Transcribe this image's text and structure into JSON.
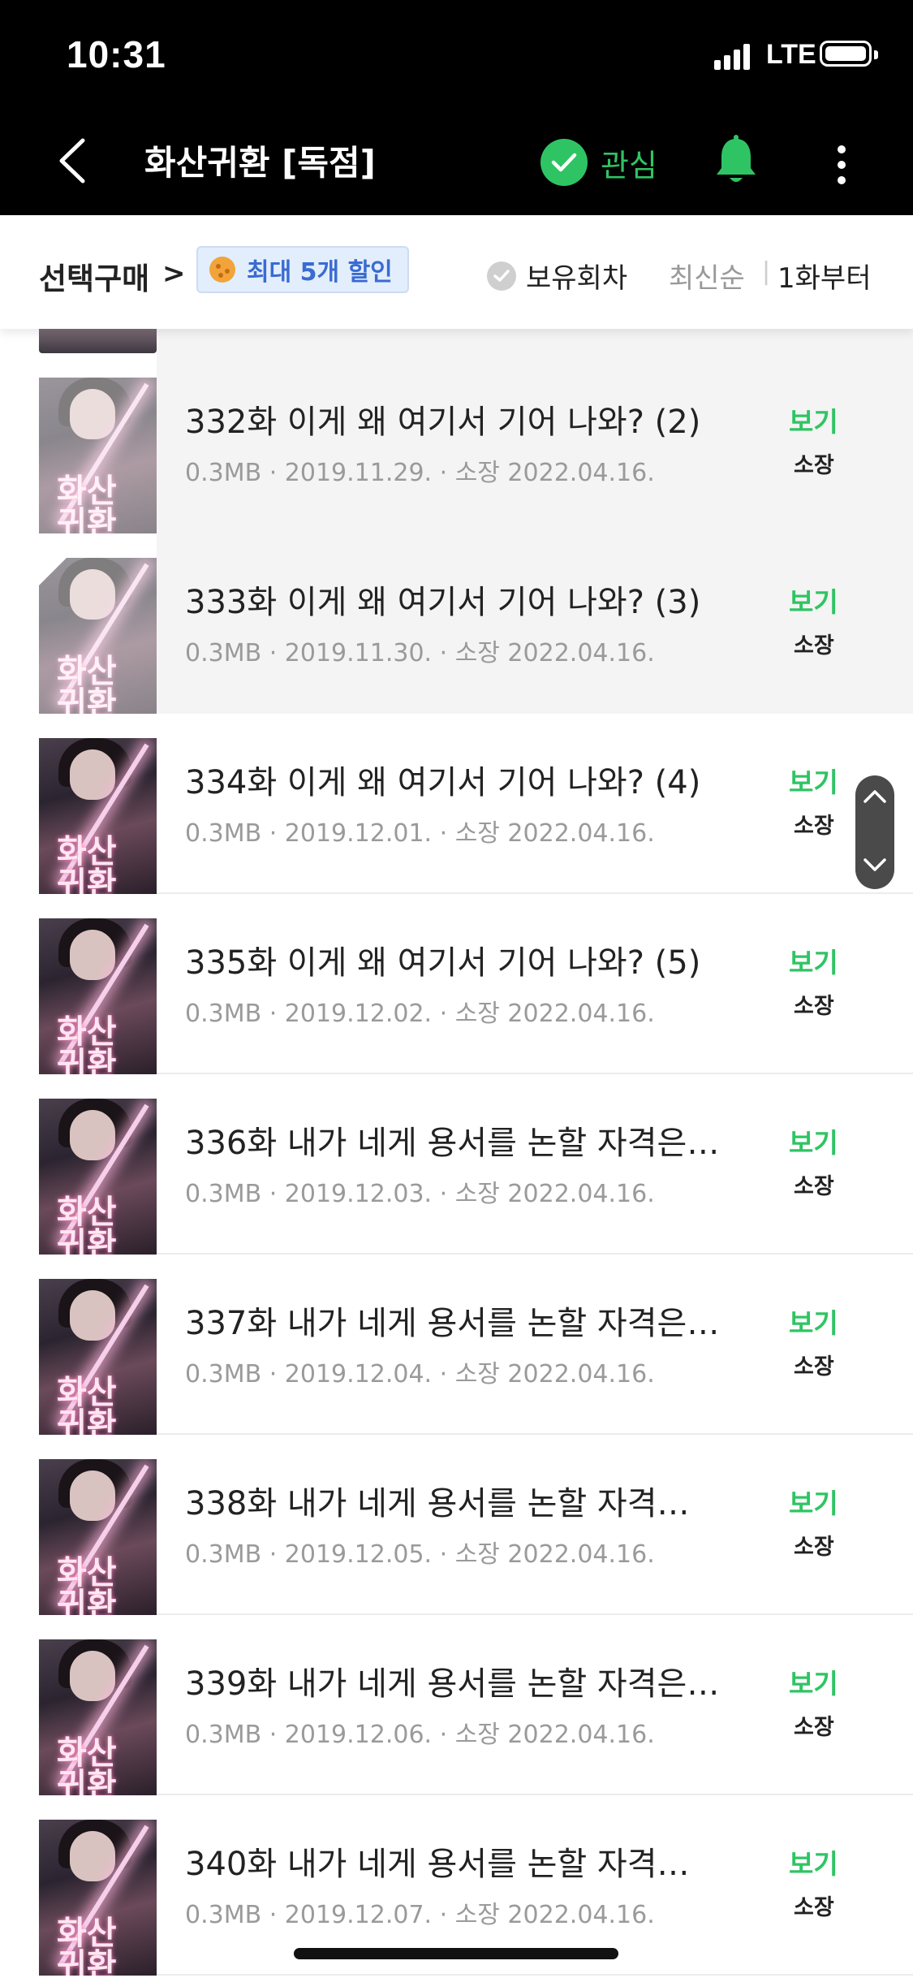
{
  "status_bar": {
    "time": "10:31",
    "network": "LTE"
  },
  "header": {
    "title": "화산귀환 [독점]",
    "interest_label": "관심"
  },
  "filter": {
    "select_buy": "선택구매",
    "chevron": ">",
    "discount": "최대 5개 할인",
    "owned": "보유회차",
    "sort_newest": "최신순",
    "separator": "|",
    "sort_first": "1화부터"
  },
  "cover_title": "화산\n귀환",
  "episodes": [
    {
      "title": "332화 이게 왜 여기서 기어 나와? (2)",
      "meta": "0.3MB · 2019.11.29. · 소장 2022.04.16.",
      "action": "보기",
      "owned": "소장",
      "read": true
    },
    {
      "title": "333화 이게 왜 여기서 기어 나와? (3)",
      "meta": "0.3MB · 2019.11.30. · 소장 2022.04.16.",
      "action": "보기",
      "owned": "소장",
      "read": true
    },
    {
      "title": "334화 이게 왜 여기서 기어 나와? (4)",
      "meta": "0.3MB · 2019.12.01. · 소장 2022.04.16.",
      "action": "보기",
      "owned": "소장",
      "read": false
    },
    {
      "title": "335화 이게 왜 여기서 기어 나와? (5)",
      "meta": "0.3MB · 2019.12.02. · 소장 2022.04.16.",
      "action": "보기",
      "owned": "소장",
      "read": false
    },
    {
      "title": "336화 내가 네게 용서를 논할 자격은…",
      "meta": "0.3MB · 2019.12.03. · 소장 2022.04.16.",
      "action": "보기",
      "owned": "소장",
      "read": false
    },
    {
      "title": "337화 내가 네게 용서를 논할 자격은…",
      "meta": "0.3MB · 2019.12.04. · 소장 2022.04.16.",
      "action": "보기",
      "owned": "소장",
      "read": false
    },
    {
      "title": "338화 내가 네게 용서를 논할 자격…",
      "meta": "0.3MB · 2019.12.05. · 소장 2022.04.16.",
      "action": "보기",
      "owned": "소장",
      "read": false
    },
    {
      "title": "339화 내가 네게 용서를 논할 자격은…",
      "meta": "0.3MB · 2019.12.06. · 소장 2022.04.16.",
      "action": "보기",
      "owned": "소장",
      "read": false
    },
    {
      "title": "340화 내가 네게 용서를 논할 자격…",
      "meta": "0.3MB · 2019.12.07. · 소장 2022.04.16.",
      "action": "보기",
      "owned": "소장",
      "read": false
    }
  ],
  "colors": {
    "accent_green": "#2fc463",
    "discount_blue": "#3a6bd1",
    "header_bg": "#000000"
  },
  "icons": [
    "back-icon",
    "check-icon",
    "bell-icon",
    "more-icon",
    "cookie-icon",
    "scroll-up-icon",
    "scroll-down-icon"
  ]
}
